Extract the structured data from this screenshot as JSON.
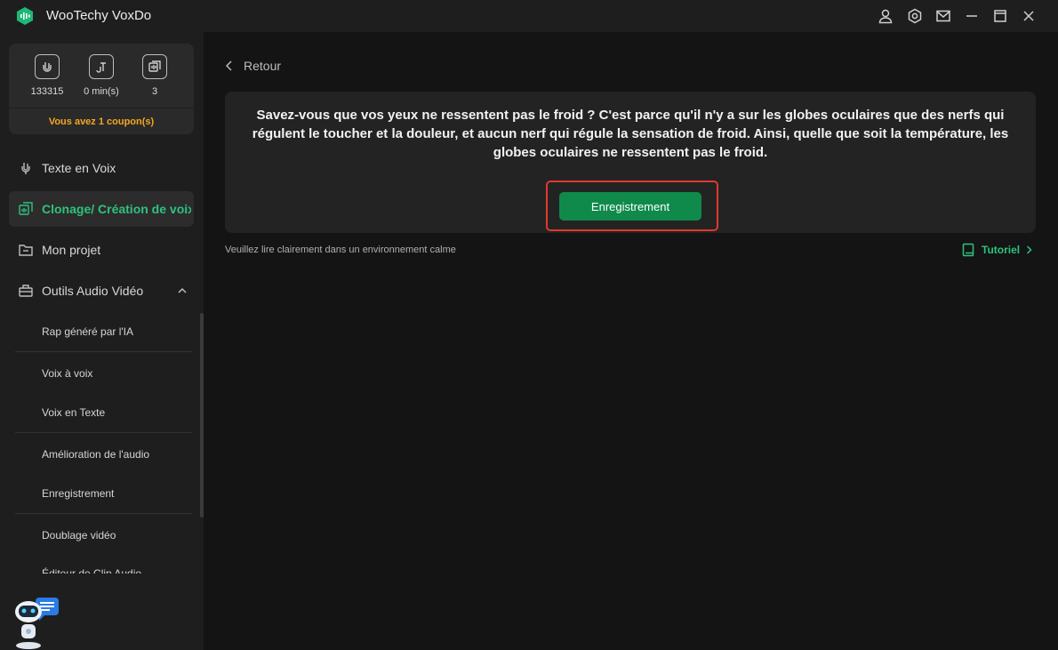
{
  "window": {
    "title": "WooTechy VoxDo",
    "controls": [
      "account-icon",
      "settings-icon",
      "mail-icon",
      "minimize-icon",
      "maximize-icon",
      "close-icon"
    ]
  },
  "sidebar": {
    "stats": [
      {
        "icon": "character-count-icon",
        "value": "133315"
      },
      {
        "icon": "minutes-icon",
        "value": "0 min(s)"
      },
      {
        "icon": "voice-count-icon",
        "value": "3"
      }
    ],
    "coupon": "Vous avez 1 coupon(s)",
    "items": [
      {
        "label": "Texte en Voix",
        "icon": "microphone-icon"
      },
      {
        "label": "Clonage/ Création de voix",
        "icon": "clone-icon",
        "active": true
      },
      {
        "label": "Mon projet",
        "icon": "folder-icon"
      },
      {
        "label": "Outils Audio Vidéo",
        "icon": "toolbox-icon"
      }
    ],
    "sub_items": [
      "Rap généré par l'IA",
      "Voix à voix",
      "Voix en Texte",
      "Amélioration de l'audio",
      "Enregistrement",
      "Doublage vidéo",
      "Éditeur de Clip Audio"
    ]
  },
  "main": {
    "back_label": "Retour",
    "prompt": "Savez-vous que vos yeux ne ressentent pas le froid ? C'est parce qu'il n'y a sur les globes oculaires que des nerfs qui régulent le toucher et la douleur, et aucun nerf qui régule la sensation de froid. Ainsi, quelle que soit la température, les globes oculaires ne ressentent pas le froid.",
    "record_button": "Enregistrement",
    "hint": "Veuillez lire clairement dans un environnement calme",
    "tutorial": "Tutoriel"
  },
  "colors": {
    "accent": "#2ec27e",
    "button": "#0f8a4a",
    "highlight": "#e0392b",
    "coupon": "#f5a623"
  }
}
